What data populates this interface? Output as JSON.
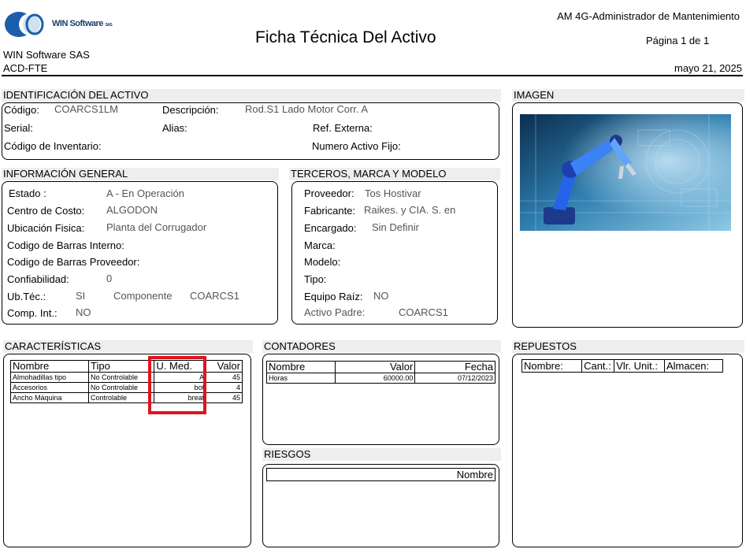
{
  "header": {
    "logo_text": "WIN Software",
    "logo_suffix": "SAS",
    "title": "Ficha Técnica Del Activo",
    "module": "AM 4G-Administrador de Mantenimiento",
    "page_label": "Página 1 de  1",
    "company": "WIN Software SAS",
    "code": "ACD-FTE",
    "date": "mayo 21, 2025"
  },
  "identificacion": {
    "title": "IDENTIFICACIÓN DEL ACTIVO",
    "codigo_label": "Código:",
    "codigo_value": "COARCS1LM",
    "descripcion_label": "Descripción:",
    "descripcion_value": "Rod.S1 Lado Motor Corr. A",
    "serial_label": "Serial:",
    "alias_label": "Alias:",
    "ref_label": "Ref. Externa:",
    "inventario_label": "Código de Inventario:",
    "activo_fijo_label": "Numero Activo Fijo:"
  },
  "imagen": {
    "title": "IMAGEN"
  },
  "general": {
    "title": "INFORMACIÓN GENERAL",
    "estado_label": "Estado :",
    "estado_value": "A - En Operación",
    "centro_label": "Centro de Costo:",
    "centro_value": "ALGODON",
    "ubicacion_label": "Ubicación Fisica:",
    "ubicacion_value": "Planta del Corrugador",
    "barras_int_label": "Codigo de Barras Interno:",
    "barras_prov_label": "Codigo de Barras Proveedor:",
    "confiabilidad_label": "Confiabilidad:",
    "confiabilidad_value": "0",
    "ubtec_label": "Ub.Téc.:",
    "ubtec_value": "SI",
    "componente_label": "Componente",
    "componente_value": "COARCS1",
    "compint_label": "Comp. Int.:",
    "compint_value": "NO"
  },
  "terceros": {
    "title": "TERCEROS, MARCA Y MODELO",
    "proveedor_label": "Proveedor:",
    "proveedor_value": "Tos Hostivar",
    "fabricante_label": "Fabricante:",
    "fabricante_value": "Raikes.  y  CIA. S. en",
    "encargado_label": "Encargado:",
    "encargado_value": "Sin Definir",
    "marca_label": "Marca:",
    "modelo_label": "Modelo:",
    "tipo_label": "Tipo:",
    "raiz_label": "Equipo Raíz:",
    "raiz_value": "NO",
    "padre_label": "Activo Padre:",
    "padre_value": "COARCS1"
  },
  "caracteristicas": {
    "title": "CARACTERÍSTICAS",
    "headers": [
      "Nombre",
      "Tipo",
      "U. Med.",
      "Valor"
    ],
    "rows": [
      [
        "Almohadillas tipo",
        "No Controlable",
        "A",
        "45"
      ],
      [
        "Accesorios",
        "No Controlable",
        "bot",
        "4"
      ],
      [
        "Ancho Máquina",
        "Controlable",
        "breat",
        "45"
      ]
    ]
  },
  "contadores": {
    "title": "CONTADORES",
    "headers": [
      "Nombre",
      "Valor",
      "Fecha"
    ],
    "rows": [
      [
        "Horas",
        "60000.00",
        "07/12/2023"
      ]
    ]
  },
  "riesgos": {
    "title": "RIESGOS",
    "header": "Nombre"
  },
  "repuestos": {
    "title": "REPUESTOS",
    "headers": [
      "Nombre:",
      "Cant.:",
      "Vlr. Unit.:",
      "Almacen:"
    ]
  },
  "colors": {
    "highlight": "#e0141e",
    "section_bg": "#eeeeee",
    "logo_blue": "#1b5fa8"
  }
}
